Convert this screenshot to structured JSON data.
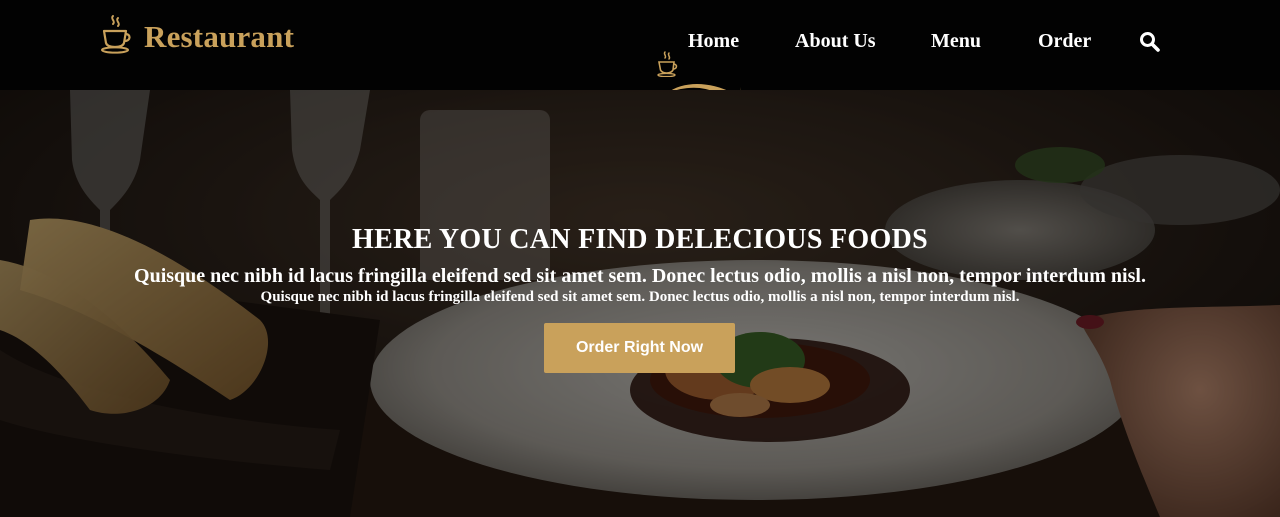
{
  "brand": {
    "name": "Restaurant",
    "icon": "coffee-cup-icon",
    "color": "#c9a15b"
  },
  "nav": {
    "items": [
      {
        "label": "Home",
        "active": true
      },
      {
        "label": "About Us",
        "active": false
      },
      {
        "label": "Menu",
        "active": false
      },
      {
        "label": "Order",
        "active": false
      }
    ],
    "active_icon": "coffee-cup-icon",
    "search_icon": "search-icon"
  },
  "hero": {
    "title": "HERE YOU CAN FIND DELECIOUS FOODS",
    "subtitle_large": "Quisque nec nibh id lacus fringilla eleifend sed sit amet sem. Donec lectus odio, mollis a nisl non, tempor interdum nisl.",
    "subtitle_small": "Quisque nec nibh id lacus fringilla eleifend sed sit amet sem. Donec lectus odio, mollis a nisl non, tempor interdum nisl.",
    "cta_label": "Order Right Now",
    "accent_color": "#c9a15b"
  }
}
